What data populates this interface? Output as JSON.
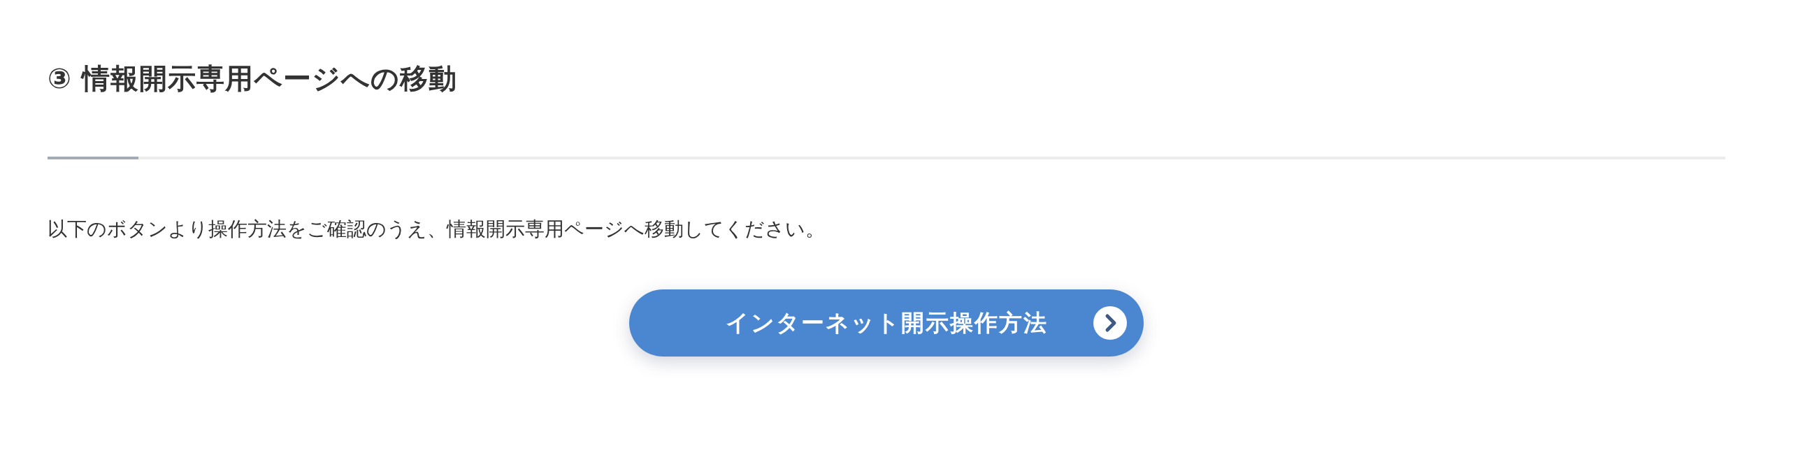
{
  "heading": {
    "number": "③",
    "title": "情報開示専用ページへの移動"
  },
  "description": "以下のボタンより操作方法をご確認のうえ、情報開示専用ページへ移動してください。",
  "button": {
    "label": "インターネット開示操作方法"
  }
}
